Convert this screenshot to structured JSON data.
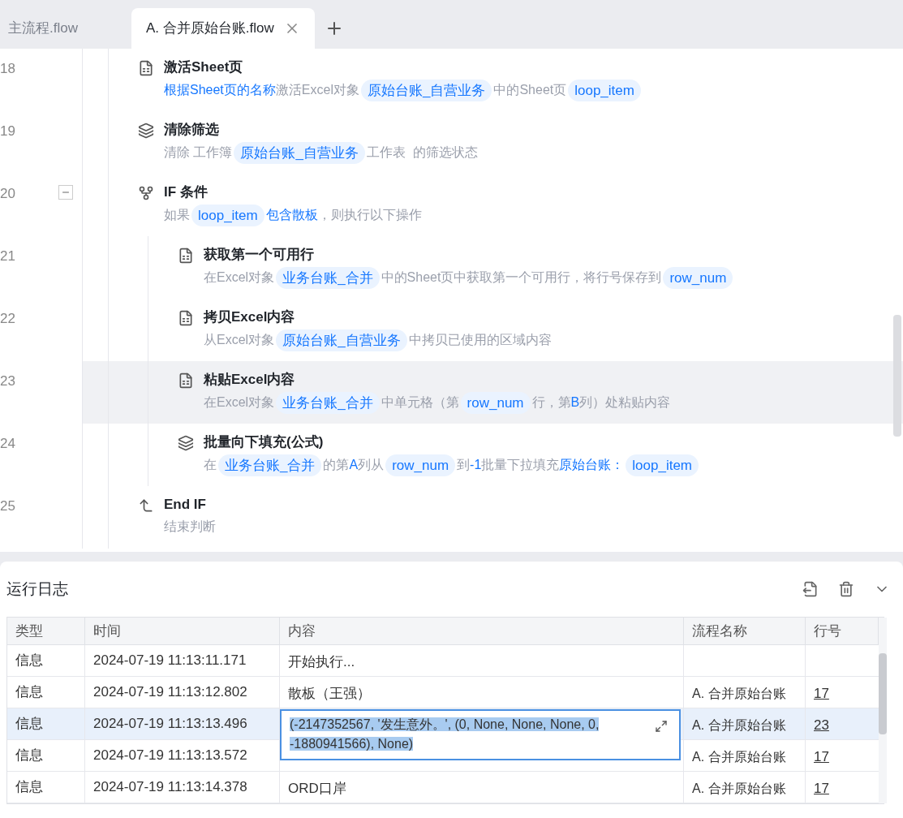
{
  "tabs": [
    {
      "label": "主流程.flow",
      "selected": false
    },
    {
      "label": "A. 合并原始台账.flow",
      "selected": true
    }
  ],
  "steps": [
    {
      "line": "18",
      "kind": "sheet",
      "title": "激活Sheet页",
      "selected": false,
      "desc": [
        {
          "kind": "link",
          "text": "根据Sheet页的名称"
        },
        {
          "kind": "text",
          "text": "激活Excel对象"
        },
        {
          "kind": "var",
          "text": "原始台账_自营业务"
        },
        {
          "kind": "text",
          "text": "中的Sheet页"
        },
        {
          "kind": "var",
          "text": "loop_item"
        }
      ]
    },
    {
      "line": "19",
      "kind": "layers",
      "title": "清除筛选",
      "selected": false,
      "desc": [
        {
          "kind": "text",
          "text": "清除 工作簿"
        },
        {
          "kind": "var",
          "text": "原始台账_自营业务"
        },
        {
          "kind": "text",
          "text": "工作表  的筛选状态"
        }
      ]
    },
    {
      "line": "20",
      "kind": "if",
      "title": "IF 条件",
      "selected": false,
      "expanded": true,
      "desc": [
        {
          "kind": "text",
          "text": "如果"
        },
        {
          "kind": "var",
          "text": "loop_item"
        },
        {
          "kind": "link",
          "text": "包含散板"
        },
        {
          "kind": "text",
          "text": "，则执行以下操作"
        }
      ],
      "children": [
        {
          "line": "21",
          "kind": "sheet",
          "title": "获取第一个可用行",
          "selected": false,
          "desc": [
            {
              "kind": "text",
              "text": "在Excel对象"
            },
            {
              "kind": "var",
              "text": "业务台账_合并"
            },
            {
              "kind": "text",
              "text": "中的Sheet页中获取第一个可用行，将行号保存到"
            },
            {
              "kind": "var",
              "text": "row_num"
            }
          ]
        },
        {
          "line": "22",
          "kind": "sheet",
          "title": "拷贝Excel内容",
          "selected": false,
          "desc": [
            {
              "kind": "text",
              "text": "从Excel对象"
            },
            {
              "kind": "var",
              "text": "原始台账_自营业务"
            },
            {
              "kind": "text",
              "text": "中拷贝已使用的区域内容"
            }
          ]
        },
        {
          "line": "23",
          "kind": "sheet",
          "title": "粘贴Excel内容",
          "selected": true,
          "desc": [
            {
              "kind": "text",
              "text": "在Excel对象"
            },
            {
              "kind": "var",
              "text": "业务台账_合并"
            },
            {
              "kind": "text",
              "text": "中单元格（第"
            },
            {
              "kind": "var",
              "text": "row_num"
            },
            {
              "kind": "text",
              "text": "行，第"
            },
            {
              "kind": "link",
              "text": "B"
            },
            {
              "kind": "text",
              "text": "列）处粘贴内容"
            }
          ]
        },
        {
          "line": "24",
          "kind": "layers",
          "title": "批量向下填充(公式)",
          "selected": false,
          "desc": [
            {
              "kind": "text",
              "text": "在"
            },
            {
              "kind": "var",
              "text": "业务台账_合并"
            },
            {
              "kind": "text",
              "text": "的第"
            },
            {
              "kind": "link",
              "text": "A"
            },
            {
              "kind": "text",
              "text": "列从"
            },
            {
              "kind": "var",
              "text": "row_num"
            },
            {
              "kind": "text",
              "text": "到"
            },
            {
              "kind": "link",
              "text": "-1"
            },
            {
              "kind": "text",
              "text": "批量下拉填充"
            },
            {
              "kind": "link",
              "text": "原始台账："
            },
            {
              "kind": "var",
              "text": "loop_item"
            }
          ]
        }
      ]
    },
    {
      "line": "25",
      "kind": "endif",
      "title": "End IF",
      "selected": false,
      "desc": [
        {
          "kind": "text",
          "text": "结束判断"
        }
      ]
    }
  ],
  "log": {
    "title": "运行日志",
    "columns": [
      "类型",
      "时间",
      "内容",
      "流程名称",
      "行号"
    ],
    "rows": [
      {
        "type": "信息",
        "time": "2024-07-19 11:13:11.171",
        "content": "开始执行...",
        "selected": false,
        "expanded": false
      },
      {
        "type": "信息",
        "time": "2024-07-19 11:13:12.802",
        "content": "散板（王强）",
        "flow": "A. 合并原始台账",
        "line": "17",
        "selected": false,
        "expanded": false
      },
      {
        "type": "信息",
        "time": "2024-07-19 11:13:13.496",
        "content": "(-2147352567, '发生意外。', (0, None, None, None, 0, -1880941566), None)",
        "flow": "A. 合并原始台账",
        "line": "23",
        "selected": true,
        "expanded": true
      },
      {
        "type": "信息",
        "time": "2024-07-19 11:13:13.572",
        "flow": "A. 合并原始台账",
        "line": "17",
        "selected": false,
        "expanded": false
      },
      {
        "type": "信息",
        "time": "2024-07-19 11:13:14.378",
        "content": "ORD口岸",
        "flow": "A. 合并原始台账",
        "line": "17",
        "selected": false,
        "expanded": false
      }
    ]
  }
}
